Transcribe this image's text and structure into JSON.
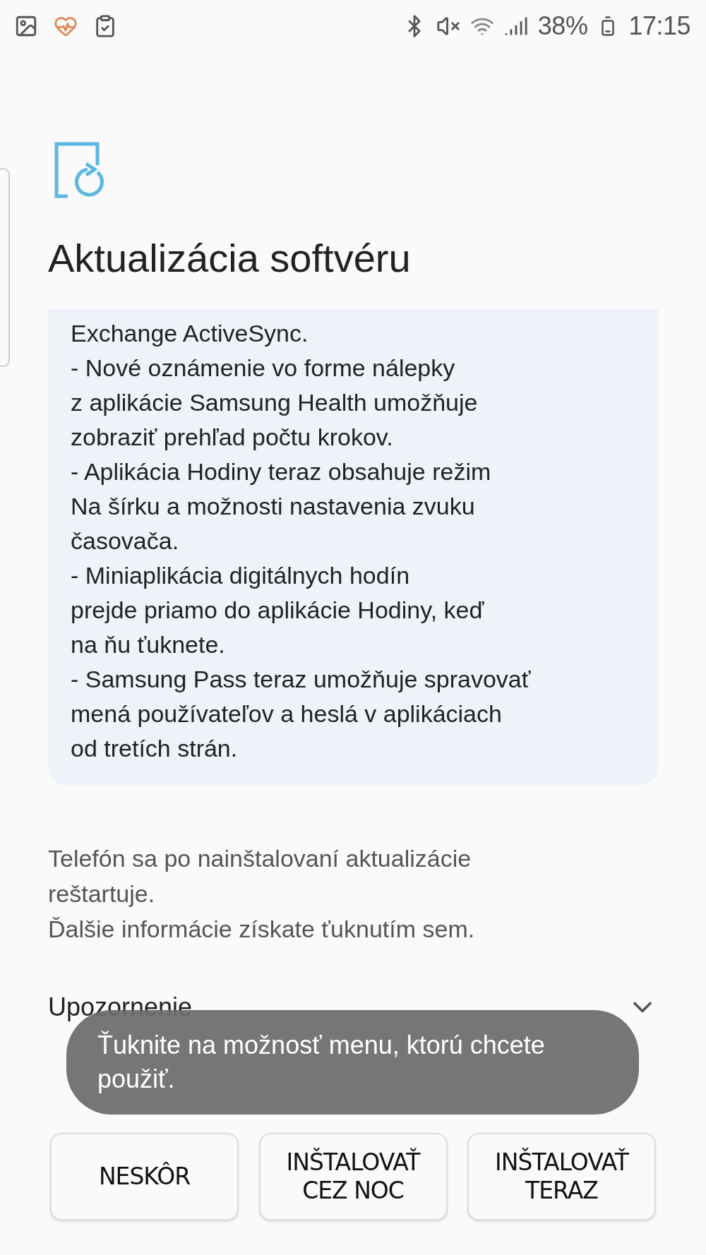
{
  "status_bar": {
    "battery": "38%",
    "time": "17:15"
  },
  "title": "Aktualizácia softvéru",
  "release_notes": "Exchange ActiveSync.\n- Nové oznámenie vo forme nálepky\nz aplikácie Samsung Health umožňuje\nzobraziť prehľad počtu krokov.\n- Aplikácia Hodiny teraz obsahuje režim\nNa šírku a možnosti nastavenia zvuku\nčasovača.\n- Miniaplikácia digitálnych hodín\nprejde priamo do aplikácie Hodiny, keď\nna ňu ťuknete.\n- Samsung Pass teraz umožňuje spravovať\nmená používateľov a heslá v aplikáciach\nod tretích strán.",
  "restart_note": "Telefón sa po nainštalovaní aktualizácie\nreštartuje.",
  "more_info": "Ďalšie informácie získate ťuknutím sem.",
  "warning": {
    "label": "Upozornenie",
    "expanded": false
  },
  "toast": "Ťuknite na možnosť menu, ktorú chcete použiť.",
  "buttons": [
    {
      "label": "NESKÔR"
    },
    {
      "label": "INŠTALOVAŤ\nCEZ NOC"
    },
    {
      "label": "INŠTALOVAŤ\nTERAZ"
    }
  ]
}
